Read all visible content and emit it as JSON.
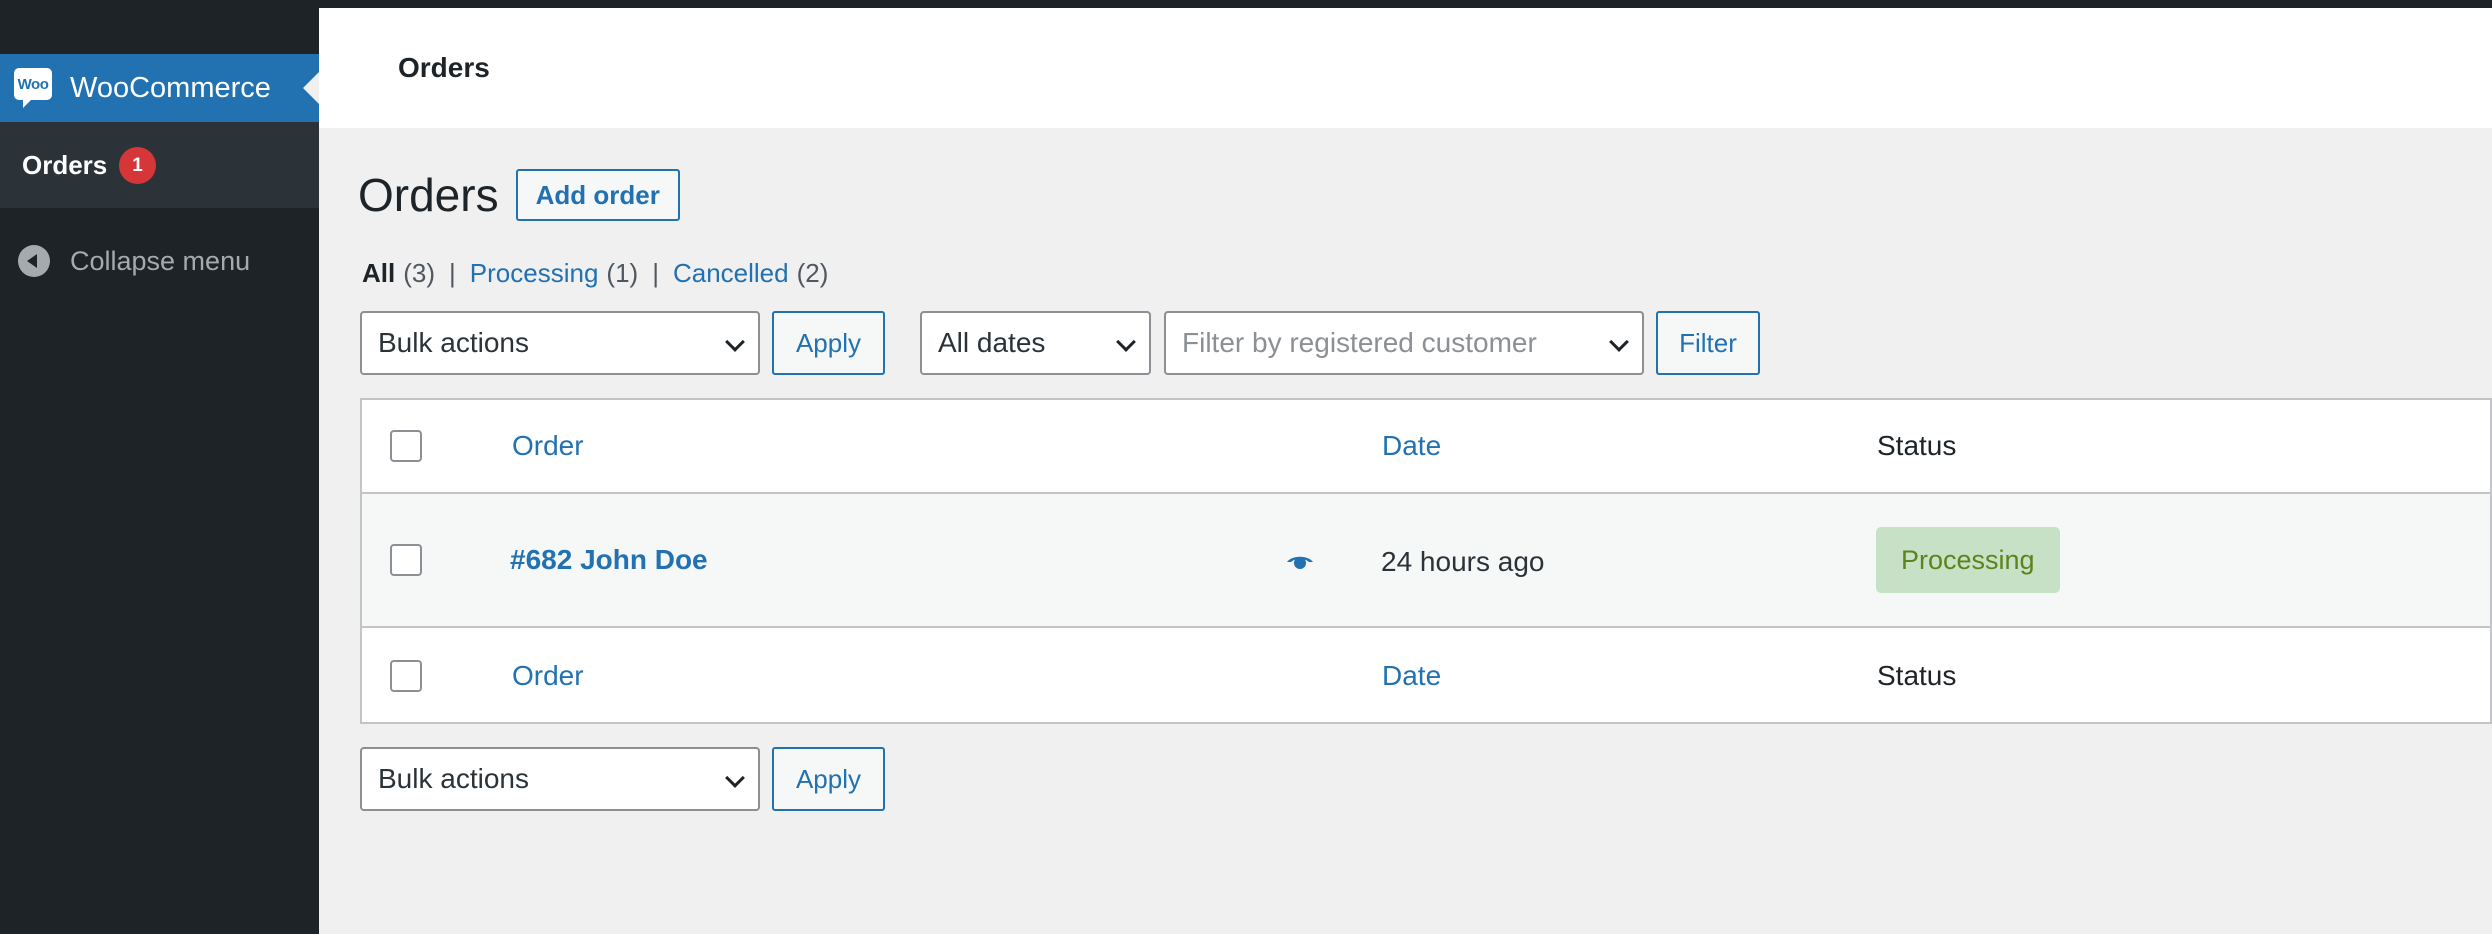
{
  "sidebar": {
    "brand_label": "WooCommerce",
    "logo_text": "Woo",
    "submenu_label": "Orders",
    "badge_count": "1",
    "collapse_label": "Collapse menu"
  },
  "header": {
    "title": "Orders"
  },
  "main": {
    "page_title": "Orders",
    "add_order_label": "Add order",
    "views": [
      {
        "label": "All",
        "count": "(3)"
      },
      {
        "label": "Processing",
        "count": "(1)"
      },
      {
        "label": "Cancelled",
        "count": "(2)"
      }
    ],
    "view_separator": "|",
    "bulk_actions_value": "Bulk actions",
    "apply_label": "Apply",
    "dates_value": "All dates",
    "customer_placeholder": "Filter by registered customer",
    "filter_label": "Filter"
  },
  "table": {
    "columns": [
      "Order",
      "Date",
      "Status"
    ],
    "rows": [
      {
        "order": "#682 John Doe",
        "date": "24 hours ago",
        "status": "Processing"
      }
    ]
  },
  "colors": {
    "accent": "#2271b1",
    "sidebar": "#1d2327",
    "badge": "#d63638",
    "status_processing_bg": "#c6e1c6",
    "status_processing_text": "#5b841b"
  }
}
